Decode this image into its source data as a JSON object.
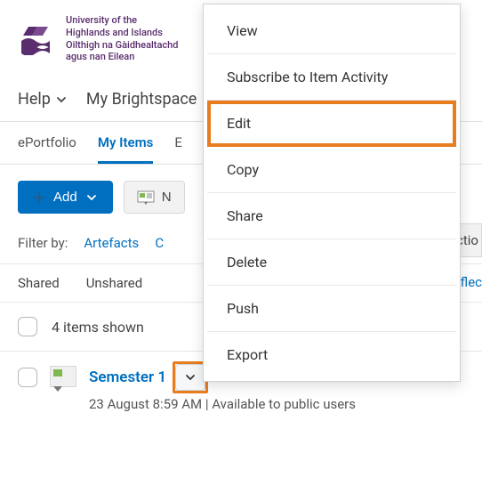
{
  "logo": {
    "line1": "University of the",
    "line2": "Highlands and Islands",
    "line3": "Oilthigh na Gàidhealtachd",
    "line4": "agus nan Eilean"
  },
  "nav": {
    "help": "Help",
    "brightspace": "My Brightspace"
  },
  "tabs": {
    "eportfolio": "ePortfolio",
    "my_items": "My Items",
    "frag_e": "E"
  },
  "toolbar": {
    "add_label": "Add",
    "secondary_icon_label": "N",
    "right_pill": "ctio"
  },
  "filters": {
    "label": "Filter by:",
    "artefacts": "Artefacts",
    "frag_c": "C",
    "right_frag": "flec"
  },
  "share_tabs": {
    "shared": "Shared",
    "unshared": "Unshared"
  },
  "items": {
    "count_text": "4 items shown",
    "semester1": {
      "title": "Semester 1",
      "meta": "23 August 8:59 AM | Available to public users"
    }
  },
  "menu": {
    "view": "View",
    "subscribe": "Subscribe to Item Activity",
    "edit": "Edit",
    "copy": "Copy",
    "share": "Share",
    "delete": "Delete",
    "push": "Push",
    "export": "Export"
  },
  "colors": {
    "primary": "#006fbf",
    "highlight": "#e87d1f",
    "brand": "#5a2d6e"
  }
}
